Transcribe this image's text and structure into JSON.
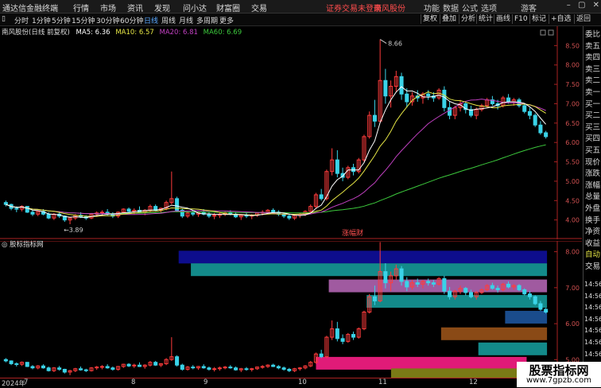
{
  "topbar": {
    "app_title": "通达信金融终端",
    "menus": [
      "行情",
      "市场",
      "资讯",
      "发现",
      "问小达",
      "财富圈",
      "交易"
    ],
    "warning": "证券交易未登录",
    "stock_link": "南风股份",
    "right_menus": [
      "功能",
      "数据",
      "公式",
      "选项"
    ],
    "guest": "游客"
  },
  "toolbar": {
    "timeframes": [
      "分时",
      "1分钟",
      "5分钟",
      "15分钟",
      "30分钟",
      "60分钟",
      "日线",
      "周线",
      "月线",
      "多周期",
      "更多"
    ],
    "active_timeframe": "日线",
    "buttons": [
      "复权",
      "叠加",
      "分析",
      "统计",
      "画线",
      "F10",
      "标记",
      "+自选",
      "返回"
    ]
  },
  "chart_legend": {
    "title": "南风股份(日线 前复权)",
    "ma5": "MA5: 6.36",
    "ma10": "MA10: 6.57",
    "ma20": "MA20: 6.81",
    "ma60": "MA60: 6.69"
  },
  "sub_legend": "股标指标网",
  "right_panel": [
    "委比",
    "卖五",
    "卖四",
    "卖三",
    "卖二",
    "卖一",
    "买一",
    "买二",
    "买三",
    "买四",
    "买五",
    "现价",
    "涨跌",
    "涨幅",
    "总量",
    "外盘",
    "换手",
    "净资",
    "收益",
    "自动",
    "交易"
  ],
  "right_times": [
    "14:56",
    "14:56",
    "14:56",
    "14:56",
    "14:56",
    "14:56",
    "14:56",
    "14:56",
    "14:56"
  ],
  "colors": {
    "up": "#ff3c3c",
    "down": "#3ad3e8",
    "ma5": "#ffffff",
    "ma10": "#e5e545",
    "ma20": "#c040c0",
    "ma60": "#3cc83c",
    "background": "#000000"
  },
  "date_axis": [
    "2024年",
    "7",
    "8",
    "9",
    "10",
    "11",
    "12"
  ],
  "annotations": {
    "high": "8.66",
    "low": "3.89",
    "center": "涨幅财"
  },
  "chart_data": [
    {
      "type": "candlestick",
      "title": "南风股份(日线 前复权)",
      "ylim": [
        3.5,
        9.0
      ],
      "yticks": [
        4.0,
        4.5,
        5.0,
        5.5,
        6.0,
        6.5,
        7.0,
        7.5,
        8.0,
        8.5
      ],
      "x_month_labels": [
        "7",
        "8",
        "9",
        "10",
        "11",
        "12"
      ],
      "candles": [
        [
          4.45,
          4.5,
          4.35,
          4.4
        ],
        [
          4.4,
          4.42,
          4.25,
          4.3
        ],
        [
          4.3,
          4.35,
          4.2,
          4.28
        ],
        [
          4.28,
          4.38,
          4.22,
          4.35
        ],
        [
          4.35,
          4.36,
          4.18,
          4.2
        ],
        [
          4.2,
          4.25,
          4.1,
          4.15
        ],
        [
          4.15,
          4.25,
          4.1,
          4.22
        ],
        [
          4.22,
          4.28,
          4.12,
          4.15
        ],
        [
          4.15,
          4.2,
          4.02,
          4.05
        ],
        [
          4.05,
          4.18,
          4.0,
          4.15
        ],
        [
          4.15,
          4.22,
          4.05,
          4.1
        ],
        [
          4.1,
          4.12,
          3.95,
          4.0
        ],
        [
          4.0,
          4.08,
          3.89,
          4.05
        ],
        [
          4.05,
          4.15,
          4.0,
          4.12
        ],
        [
          4.12,
          4.2,
          4.05,
          4.08
        ],
        [
          4.08,
          4.12,
          4.0,
          4.05
        ],
        [
          4.05,
          4.18,
          4.02,
          4.15
        ],
        [
          4.15,
          4.22,
          4.08,
          4.18
        ],
        [
          4.18,
          4.25,
          4.1,
          4.2
        ],
        [
          4.2,
          4.28,
          4.12,
          4.15
        ],
        [
          4.15,
          4.2,
          4.05,
          4.1
        ],
        [
          4.1,
          4.22,
          4.05,
          4.2
        ],
        [
          4.2,
          4.3,
          4.15,
          4.28
        ],
        [
          4.28,
          4.32,
          4.18,
          4.22
        ],
        [
          4.22,
          4.3,
          4.15,
          4.25
        ],
        [
          4.25,
          4.35,
          4.18,
          4.2
        ],
        [
          4.2,
          4.28,
          4.12,
          4.25
        ],
        [
          4.25,
          4.4,
          4.2,
          4.35
        ],
        [
          4.35,
          4.4,
          4.22,
          4.25
        ],
        [
          4.25,
          4.32,
          4.18,
          4.3
        ],
        [
          4.3,
          4.5,
          4.25,
          4.45
        ],
        [
          4.45,
          5.25,
          4.4,
          4.55
        ],
        [
          4.55,
          4.6,
          4.2,
          4.25
        ],
        [
          4.25,
          4.3,
          4.05,
          4.1
        ],
        [
          4.1,
          4.22,
          4.05,
          4.18
        ],
        [
          4.18,
          4.25,
          4.1,
          4.15
        ],
        [
          4.15,
          4.22,
          4.08,
          4.2
        ],
        [
          4.2,
          4.28,
          4.12,
          4.15
        ],
        [
          4.15,
          4.2,
          4.05,
          4.1
        ],
        [
          4.1,
          4.18,
          4.02,
          4.12
        ],
        [
          4.12,
          4.2,
          4.05,
          4.15
        ],
        [
          4.15,
          4.22,
          4.1,
          4.18
        ],
        [
          4.18,
          4.25,
          4.12,
          4.15
        ],
        [
          4.15,
          4.2,
          4.05,
          4.08
        ],
        [
          4.08,
          4.15,
          4.0,
          4.12
        ],
        [
          4.12,
          4.18,
          4.05,
          4.1
        ],
        [
          4.1,
          4.15,
          4.02,
          4.12
        ],
        [
          4.12,
          4.2,
          4.08,
          4.18
        ],
        [
          4.18,
          4.25,
          4.12,
          4.2
        ],
        [
          4.2,
          4.28,
          4.15,
          4.25
        ],
        [
          4.25,
          4.3,
          4.18,
          4.2
        ],
        [
          4.2,
          4.25,
          4.1,
          4.15
        ],
        [
          4.15,
          4.2,
          4.05,
          4.1
        ],
        [
          4.1,
          4.15,
          4.0,
          4.05
        ],
        [
          4.05,
          4.15,
          4.0,
          4.12
        ],
        [
          4.12,
          4.18,
          4.05,
          4.15
        ],
        [
          4.15,
          4.25,
          4.1,
          4.22
        ],
        [
          4.22,
          4.4,
          4.18,
          4.35
        ],
        [
          4.35,
          4.7,
          4.3,
          4.65
        ],
        [
          4.65,
          4.8,
          4.5,
          4.55
        ],
        [
          4.55,
          5.3,
          4.5,
          5.25
        ],
        [
          5.25,
          5.85,
          5.15,
          5.55
        ],
        [
          5.55,
          5.8,
          5.1,
          5.2
        ],
        [
          5.2,
          5.35,
          5.0,
          5.1
        ],
        [
          5.1,
          5.4,
          5.05,
          5.35
        ],
        [
          5.35,
          5.45,
          5.15,
          5.25
        ],
        [
          5.25,
          5.6,
          5.2,
          5.55
        ],
        [
          5.55,
          6.2,
          5.5,
          6.15
        ],
        [
          6.15,
          6.8,
          6.1,
          6.7
        ],
        [
          6.7,
          7.1,
          6.4,
          6.55
        ],
        [
          6.55,
          8.66,
          6.5,
          7.6
        ],
        [
          7.6,
          7.9,
          7.0,
          7.2
        ],
        [
          7.2,
          7.6,
          6.9,
          7.45
        ],
        [
          7.45,
          7.85,
          7.3,
          7.7
        ],
        [
          7.7,
          7.8,
          7.1,
          7.25
        ],
        [
          7.25,
          7.4,
          6.9,
          7.05
        ],
        [
          7.05,
          7.3,
          6.95,
          7.2
        ],
        [
          7.2,
          7.35,
          7.05,
          7.15
        ],
        [
          7.15,
          7.3,
          7.0,
          7.25
        ],
        [
          7.25,
          7.35,
          7.1,
          7.2
        ],
        [
          7.2,
          7.3,
          7.05,
          7.15
        ],
        [
          7.15,
          7.4,
          7.1,
          7.35
        ],
        [
          7.35,
          7.45,
          6.8,
          6.9
        ],
        [
          6.9,
          7.05,
          6.6,
          6.7
        ],
        [
          6.7,
          6.95,
          6.6,
          6.9
        ],
        [
          6.9,
          7.1,
          6.8,
          7.0
        ],
        [
          7.0,
          7.05,
          6.75,
          6.85
        ],
        [
          6.85,
          6.95,
          6.65,
          6.7
        ],
        [
          6.7,
          6.9,
          6.6,
          6.85
        ],
        [
          6.85,
          7.0,
          6.8,
          6.95
        ],
        [
          6.95,
          7.15,
          6.9,
          7.1
        ],
        [
          7.1,
          7.2,
          6.95,
          7.0
        ],
        [
          7.0,
          7.1,
          6.85,
          6.95
        ],
        [
          6.95,
          7.2,
          6.9,
          7.15
        ],
        [
          7.15,
          7.25,
          7.0,
          7.05
        ],
        [
          7.05,
          7.15,
          6.95,
          7.1
        ],
        [
          7.1,
          7.15,
          6.9,
          6.95
        ],
        [
          6.95,
          7.0,
          6.75,
          6.8
        ],
        [
          6.8,
          6.9,
          6.6,
          6.7
        ],
        [
          6.7,
          6.75,
          6.4,
          6.45
        ],
        [
          6.45,
          6.55,
          6.2,
          6.25
        ],
        [
          6.25,
          6.3,
          6.1,
          6.15
        ]
      ]
    },
    {
      "type": "bar",
      "title": "股标指标网",
      "ylim": [
        4.5,
        8.3
      ],
      "yticks": [
        5.0,
        6.0,
        7.0,
        8.0
      ],
      "bands": [
        {
          "from": 0.307,
          "to": 0.94,
          "value": 7.85,
          "color": "#0d0d8c"
        },
        {
          "from": 0.328,
          "to": 0.94,
          "value": 7.5,
          "color": "#138a8a"
        },
        {
          "from": 0.565,
          "to": 0.94,
          "value": 7.05,
          "color": "#a05aa0"
        },
        {
          "from": 0.63,
          "to": 0.94,
          "value": 6.62,
          "color": "#138a8a"
        },
        {
          "from": 0.868,
          "to": 0.94,
          "value": 6.18,
          "color": "#1a4c8c"
        },
        {
          "from": 0.758,
          "to": 0.94,
          "value": 5.72,
          "color": "#8a4a16"
        },
        {
          "from": 0.822,
          "to": 0.94,
          "value": 5.3,
          "color": "#138a8a"
        },
        {
          "from": 0.543,
          "to": 0.905,
          "value": 4.9,
          "color": "#e01b78"
        },
        {
          "from": 0.672,
          "to": 0.905,
          "value": 4.58,
          "color": "#7a7a16"
        }
      ]
    }
  ]
}
